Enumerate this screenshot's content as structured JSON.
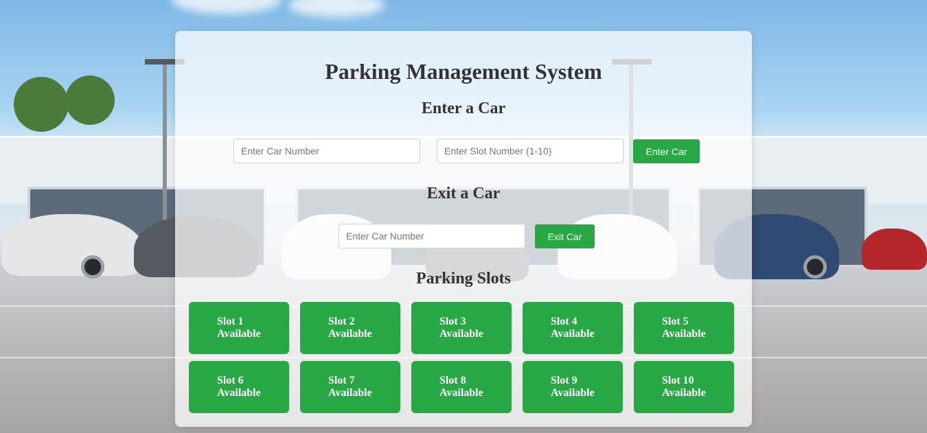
{
  "title": "Parking Management System",
  "enter_section": {
    "heading": "Enter a Car",
    "car_number_placeholder": "Enter Car Number",
    "slot_number_placeholder": "Enter Slot Number (1-10)",
    "button_label": "Enter Car"
  },
  "exit_section": {
    "heading": "Exit a Car",
    "car_number_placeholder": "Enter Car Number",
    "button_label": "Exit Car"
  },
  "slots_section": {
    "heading": "Parking Slots",
    "slots": [
      {
        "label": "Slot 1",
        "status": "Available"
      },
      {
        "label": "Slot 2",
        "status": "Available"
      },
      {
        "label": "Slot 3",
        "status": "Available"
      },
      {
        "label": "Slot 4",
        "status": "Available"
      },
      {
        "label": "Slot 5",
        "status": "Available"
      },
      {
        "label": "Slot 6",
        "status": "Available"
      },
      {
        "label": "Slot 7",
        "status": "Available"
      },
      {
        "label": "Slot 8",
        "status": "Available"
      },
      {
        "label": "Slot 9",
        "status": "Available"
      },
      {
        "label": "Slot 10",
        "status": "Available"
      }
    ]
  },
  "colors": {
    "accent": "#28a745",
    "heading_text": "#333333"
  }
}
